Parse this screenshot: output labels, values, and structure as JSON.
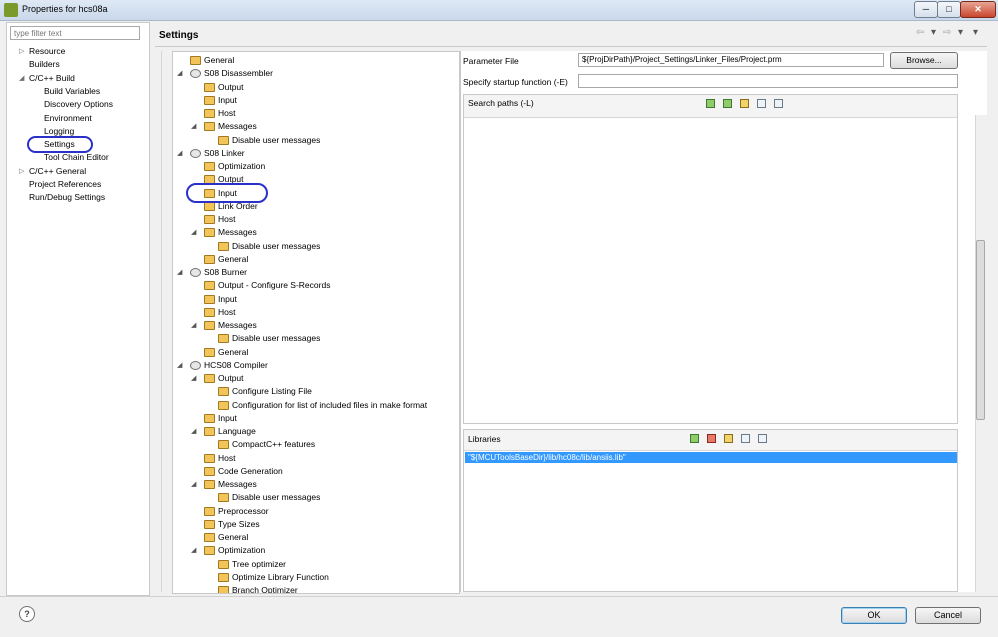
{
  "window": {
    "title": "Properties for hcs08a",
    "min_glyph": "─",
    "max_glyph": "□",
    "close_glyph": "✕"
  },
  "sidebar": {
    "filter_placeholder": "type filter text",
    "items": [
      {
        "label": "Resource",
        "expander": "▷"
      },
      {
        "label": "Builders",
        "expander": ""
      },
      {
        "label": "C/C++ Build",
        "expander": "◢"
      },
      {
        "label": "Build Variables",
        "expander": ""
      },
      {
        "label": "Discovery Options",
        "expander": ""
      },
      {
        "label": "Environment",
        "expander": ""
      },
      {
        "label": "Logging",
        "expander": ""
      },
      {
        "label": "Settings",
        "expander": ""
      },
      {
        "label": "Tool Chain Editor",
        "expander": ""
      },
      {
        "label": "C/C++ General",
        "expander": "▷"
      },
      {
        "label": "Project References",
        "expander": ""
      },
      {
        "label": "Run/Debug Settings",
        "expander": ""
      }
    ]
  },
  "header": {
    "title": "Settings",
    "nav_back": "⇦",
    "nav_back_menu": "▾",
    "nav_forward": "⇨",
    "nav_forward_menu": "▾",
    "view_menu": "▾"
  },
  "tree": [
    {
      "label": "General",
      "expander": ""
    },
    {
      "label": "S08 Disassembler",
      "expander": "◢"
    },
    {
      "label": "Output",
      "expander": ""
    },
    {
      "label": "Input",
      "expander": ""
    },
    {
      "label": "Host",
      "expander": ""
    },
    {
      "label": "Messages",
      "expander": "◢"
    },
    {
      "label": "Disable user messages",
      "expander": ""
    },
    {
      "label": "S08 Linker",
      "expander": "◢"
    },
    {
      "label": "Optimization",
      "expander": ""
    },
    {
      "label": "Output",
      "expander": ""
    },
    {
      "label": "Input",
      "expander": ""
    },
    {
      "label": "Link Order",
      "expander": ""
    },
    {
      "label": "Host",
      "expander": ""
    },
    {
      "label": "Messages",
      "expander": "◢"
    },
    {
      "label": "Disable user messages",
      "expander": ""
    },
    {
      "label": "General",
      "expander": ""
    },
    {
      "label": "S08 Burner",
      "expander": "◢"
    },
    {
      "label": "Output - Configure S-Records",
      "expander": ""
    },
    {
      "label": "Input",
      "expander": ""
    },
    {
      "label": "Host",
      "expander": ""
    },
    {
      "label": "Messages",
      "expander": "◢"
    },
    {
      "label": "Disable user messages",
      "expander": ""
    },
    {
      "label": "General",
      "expander": ""
    },
    {
      "label": "HCS08 Compiler",
      "expander": "◢"
    },
    {
      "label": "Output",
      "expander": "◢"
    },
    {
      "label": "Configure Listing File",
      "expander": ""
    },
    {
      "label": "Configuration for list of included files in make format",
      "expander": ""
    },
    {
      "label": "Input",
      "expander": ""
    },
    {
      "label": "Language",
      "expander": "◢"
    },
    {
      "label": "CompactC++ features",
      "expander": ""
    },
    {
      "label": "Host",
      "expander": ""
    },
    {
      "label": "Code Generation",
      "expander": ""
    },
    {
      "label": "Messages",
      "expander": "◢"
    },
    {
      "label": "Disable user messages",
      "expander": ""
    },
    {
      "label": "Preprocessor",
      "expander": ""
    },
    {
      "label": "Type Sizes",
      "expander": ""
    },
    {
      "label": "General",
      "expander": ""
    },
    {
      "label": "Optimization",
      "expander": "◢"
    },
    {
      "label": "Tree optimizer",
      "expander": ""
    },
    {
      "label": "Optimize Library Function",
      "expander": ""
    },
    {
      "label": "Branch Optimizer",
      "expander": ""
    }
  ],
  "form": {
    "parameter_file_label": "Parameter File",
    "parameter_file_value": "${ProjDirPath}/Project_Settings/Linker_Files/Project.prm",
    "browse_label": "Browse...",
    "startup_label": "Specify startup function (-E)",
    "startup_value": ""
  },
  "search_paths": {
    "title": "Search paths (-L)",
    "toolbar": [
      "add-icon",
      "add-from-workspace-icon",
      "edit-icon",
      "move-up-icon",
      "move-down-icon"
    ]
  },
  "libraries": {
    "title": "Libraries",
    "toolbar": [
      "add-icon",
      "delete-icon",
      "edit-icon",
      "move-up-icon",
      "move-down-icon"
    ],
    "items": [
      "\"${MCUToolsBaseDir}/lib/hc08c/lib/ansiis.lib\""
    ]
  },
  "footer": {
    "help_glyph": "?",
    "ok_label": "OK",
    "cancel_label": "Cancel"
  }
}
